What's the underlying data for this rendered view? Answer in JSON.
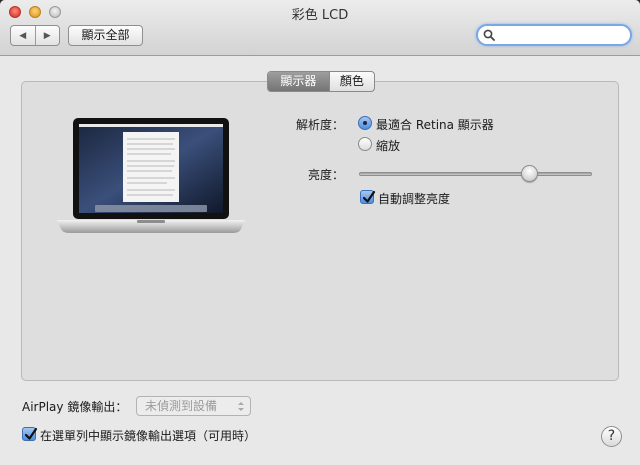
{
  "window": {
    "title": "彩色 LCD"
  },
  "toolbar": {
    "back_glyph": "◀",
    "forward_glyph": "▶",
    "show_all_label": "顯示全部",
    "search_placeholder": ""
  },
  "tabs": [
    {
      "label": "顯示器",
      "selected": true
    },
    {
      "label": "顏色",
      "selected": false
    }
  ],
  "display": {
    "resolution_label": "解析度：",
    "resolution_options": [
      {
        "label": "最適合 Retina 顯示器",
        "selected": true
      },
      {
        "label": "縮放",
        "selected": false
      }
    ],
    "brightness_label": "亮度：",
    "brightness_fraction": 0.75,
    "auto_brightness_label": "自動調整亮度",
    "auto_brightness_checked": true
  },
  "airplay": {
    "label": "AirPlay 鏡像輸出：",
    "popup_value": "未偵測到設備"
  },
  "menu_option": {
    "label": "在選單列中顯示鏡像輸出選項（可用時）",
    "checked": true
  },
  "help": {
    "glyph": "?"
  },
  "colors": {
    "accent": "#4d8fe0",
    "focus_ring": "#7ba7e4",
    "window_bg": "#e8e8e8",
    "panel_bg": "#dedede"
  }
}
